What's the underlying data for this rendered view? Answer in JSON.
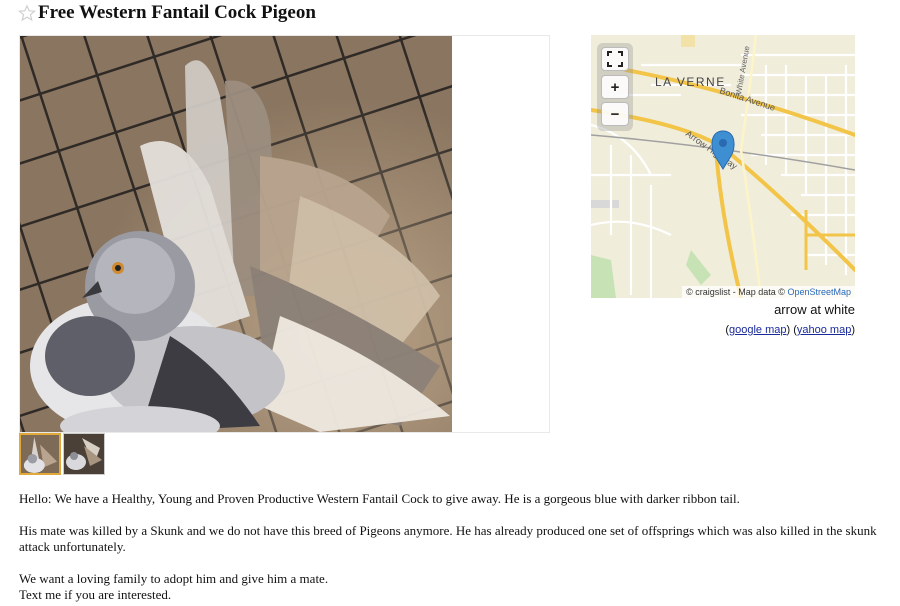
{
  "posting": {
    "title": "Free Western Fantail Cock Pigeon",
    "body": [
      "Hello: We have a Healthy, Young and Proven Productive Western Fantail Cock to give away. He is a gorgeous blue with darker ribbon tail.",
      "His mate was killed by a Skunk and we do not have this breed of Pigeons anymore. He has already produced one set of offsprings which was also killed in the skunk attack unfortunately.",
      "We want a loving family to adopt him and give him a mate.",
      "Text me if you are interested."
    ]
  },
  "gallery": {
    "thumb_count": 2,
    "selected_index": 0
  },
  "map": {
    "labels": {
      "city": "LA VERNE",
      "street1": "Bonita Avenue",
      "street2": "Arrow Highway",
      "street3": "White Avenue"
    },
    "controls": {
      "fullscreen": "⛶",
      "zoom_in": "+",
      "zoom_out": "−"
    },
    "attribution_prefix": "© craigslist - Map data ©",
    "attribution_link": "OpenStreetMap",
    "address": "arrow at white",
    "google_link": "google map",
    "yahoo_link": "yahoo map",
    "pin_color": "#3d8fd1"
  },
  "colors": {
    "title_star": "#cfcfcf",
    "link_blue": "#1a2a9a",
    "thumb_selected_border": "#e0a93a"
  }
}
